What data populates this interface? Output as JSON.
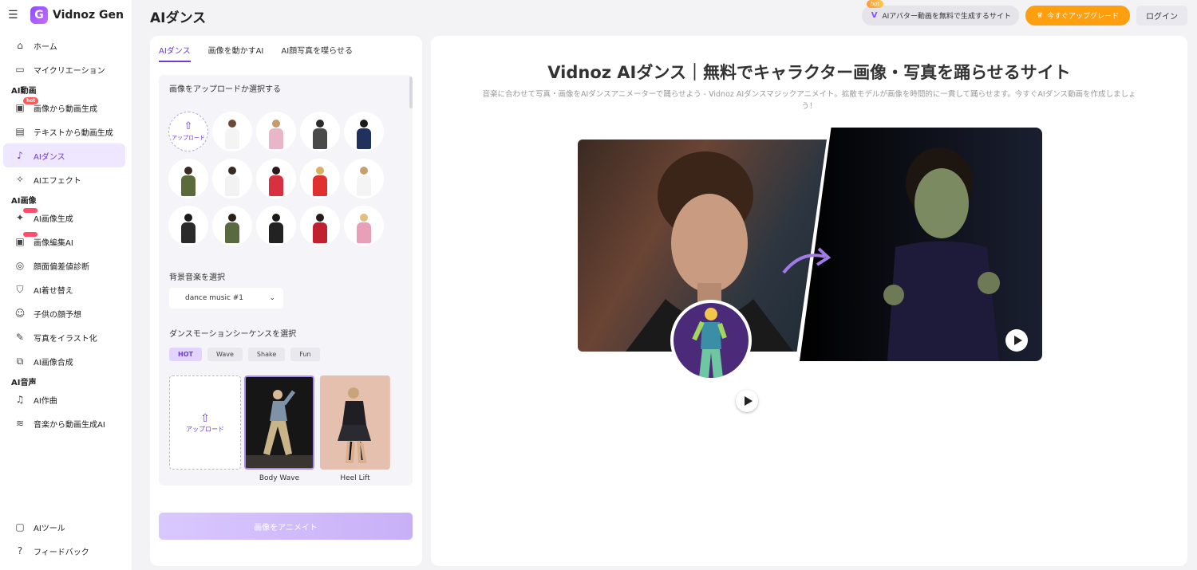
{
  "brand": {
    "name": "Vidnoz Gen",
    "logo_letter": "G"
  },
  "sidebar": {
    "top_items": [
      {
        "label": "ホーム",
        "icon": "home-icon"
      },
      {
        "label": "マイクリエーション",
        "icon": "folder-icon"
      }
    ],
    "sections": [
      {
        "title": "AI動画",
        "items": [
          {
            "label": "画像から動画生成",
            "icon": "image-video-icon",
            "badge": "hot"
          },
          {
            "label": "テキストから動画生成",
            "icon": "text-video-icon"
          },
          {
            "label": "AIダンス",
            "icon": "dance-icon",
            "active": true
          },
          {
            "label": "AIエフェクト",
            "icon": "effect-icon"
          }
        ]
      },
      {
        "title": "AI画像",
        "items": [
          {
            "label": "AI画像生成",
            "icon": "sparkle-icon",
            "badge": "new"
          },
          {
            "label": "画像編集AI",
            "icon": "image-edit-icon",
            "badge": "new"
          },
          {
            "label": "顔面偏差値診断",
            "icon": "face-scan-icon"
          },
          {
            "label": "AI着せ替え",
            "icon": "shirt-icon"
          },
          {
            "label": "子供の顔予想",
            "icon": "baby-icon"
          },
          {
            "label": "写真をイラスト化",
            "icon": "illustration-icon"
          },
          {
            "label": "AI画像合成",
            "icon": "merge-icon"
          }
        ]
      },
      {
        "title": "AI音声",
        "items": [
          {
            "label": "AI作曲",
            "icon": "music-icon"
          },
          {
            "label": "音楽から動画生成AI",
            "icon": "waveform-icon"
          }
        ]
      }
    ],
    "bottom_items": [
      {
        "label": "AIツール",
        "icon": "toolbox-icon"
      },
      {
        "label": "フィードバック",
        "icon": "help-icon"
      }
    ]
  },
  "header": {
    "title": "AIダンス",
    "promo_tag": "hot",
    "promo_label": "AIアバター動画を無料で生成するサイト",
    "upgrade_label": "今すぐアップグレード",
    "login_label": "ログイン"
  },
  "left_panel": {
    "tabs": [
      "AIダンス",
      "画像を動かすAI",
      "AI顔写真を喋らせる"
    ],
    "upload_section_label": "画像をアップロードか選択する",
    "upload_label": "アップロード",
    "music_label": "背景音楽を選択",
    "music_value": "dance music #1",
    "motion_label": "ダンスモーションシーケンスを選択",
    "motion_chips": [
      "HOT",
      "Wave",
      "Shake",
      "Fun"
    ],
    "motion_upload_label": "アップロード",
    "motions": [
      "Body Wave",
      "Heel Lift"
    ],
    "animate_button": "画像をアニメイト"
  },
  "main": {
    "title": "Vidnoz AIダンス｜無料でキャラクター画像・写真を踊らせるサイト",
    "subtitle": "音楽に合わせて写真・画像をAIダンスアニメーターで踊らせよう - Vidnoz AIダンスマジックアニメイト。拡散モデルが画像を時間的に一貫して踊らせます。今すぐAIダンス動画を作成しましょう！"
  },
  "colors": {
    "accent": "#6f3ad8",
    "upgrade": "#ff9f0f",
    "hot": "#ff5a5a"
  }
}
